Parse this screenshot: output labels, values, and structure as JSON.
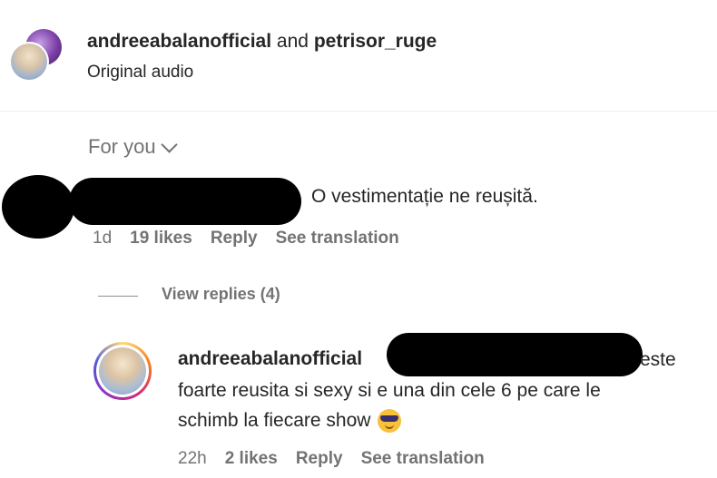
{
  "header": {
    "user1": "andreeabalanofficial",
    "joiner": "and",
    "user2": "petrisor_ruge",
    "audio_label": "Original audio"
  },
  "filter": {
    "label": "For you",
    "icon": "chevron-down-icon"
  },
  "comment": {
    "text": "O vestimentație ne reușită.",
    "time": "1d",
    "likes": "19 likes",
    "reply_label": "Reply",
    "translate_label": "See translation"
  },
  "view_replies": "View replies (4)",
  "reply": {
    "username": "andreeabalanofficial",
    "text_tail": "este",
    "text_line2": "foarte reusita si sexy si e una din cele 6 pe care le",
    "text_line3": "schimb la fiecare show",
    "emoji": "smiling-face-with-sunglasses-emoji",
    "time": "22h",
    "likes": "2 likes",
    "reply_label": "Reply",
    "translate_label": "See translation"
  }
}
